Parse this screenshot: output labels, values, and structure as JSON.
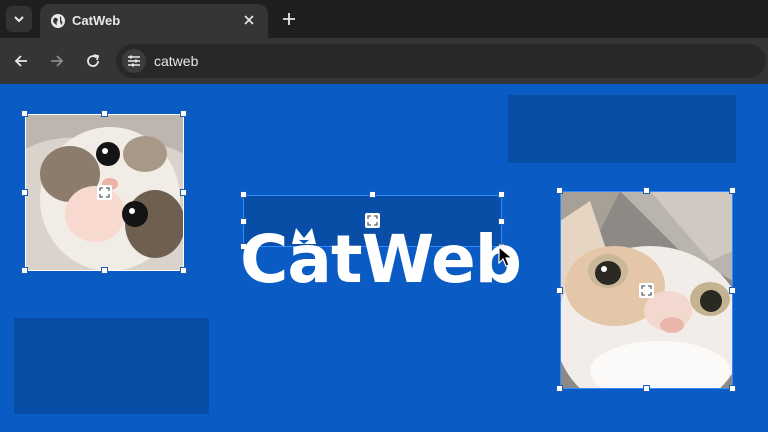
{
  "browser": {
    "tab_title": "CatWeb",
    "url": "catweb"
  },
  "page": {
    "logo_text": "CatWeb"
  },
  "colors": {
    "background": "#0a5bc4",
    "block": "#084ea6",
    "selection": "#2f8bff"
  },
  "icons": {
    "tab_menu": "chevron-down-icon",
    "favicon": "globe-icon",
    "tab_close": "close-icon",
    "new_tab": "plus-icon",
    "back": "arrow-left-icon",
    "forward": "arrow-right-icon",
    "reload": "reload-icon",
    "site_settings": "tune-icon",
    "move_handle": "move-icon",
    "cursor": "mouse-pointer-icon"
  }
}
